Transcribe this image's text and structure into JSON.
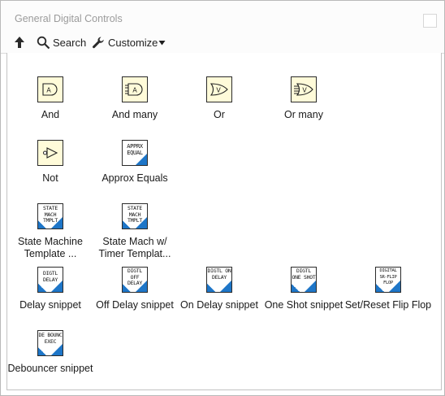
{
  "window": {
    "title": "General Digital Controls"
  },
  "toolbar": {
    "search_label": "Search",
    "customize_label": "Customize"
  },
  "items": [
    {
      "label": "And",
      "kind": "gate",
      "glyph": "A"
    },
    {
      "label": "And many",
      "kind": "gate",
      "glyph": "A"
    },
    {
      "label": "Or",
      "kind": "gate",
      "glyph": "V"
    },
    {
      "label": "Or many",
      "kind": "gate",
      "glyph": "V"
    },
    {
      "label": "Not",
      "kind": "gate",
      "glyph": ""
    },
    {
      "label": "Approx Equals",
      "kind": "vi",
      "icon_text": "APPRX EQUAL"
    },
    {
      "label": "State Machine Template ...",
      "kind": "vi",
      "icon_text": "STATE MACH TMPLT"
    },
    {
      "label": "State Mach w/ Timer Templat...",
      "kind": "vi",
      "icon_text": "STATE MACH TMPLT"
    },
    {
      "label": "Delay snippet",
      "kind": "vi",
      "icon_text": "DIGTL DELAY"
    },
    {
      "label": "Off Delay snippet",
      "kind": "vi",
      "icon_text": "DIGTL OFF DELAY"
    },
    {
      "label": "On Delay snippet",
      "kind": "vi",
      "icon_text": "DIGTL ON DELAY"
    },
    {
      "label": "One Shot snippet",
      "kind": "vi",
      "icon_text": "DIGTL ONE SHOT"
    },
    {
      "label": "Set/Reset Flip Flop",
      "kind": "vi",
      "icon_text": "DIGITAL SR-FLIP FLOP"
    },
    {
      "label": "Debouncer snippet",
      "kind": "vi",
      "icon_text": "DE BOUNC EXEC"
    }
  ],
  "colors": {
    "vi_accent": "#1e76c8",
    "gate_fill": "#fffbd9"
  }
}
